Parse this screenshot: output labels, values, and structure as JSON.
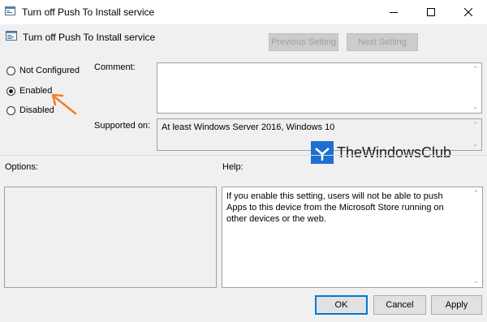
{
  "window": {
    "title": "Turn off Push To Install service"
  },
  "policy": {
    "name": "Turn off Push To Install service",
    "previous_setting_label": "Previous Setting",
    "next_setting_label": "Next Setting"
  },
  "state": {
    "options": [
      "Not Configured",
      "Enabled",
      "Disabled"
    ],
    "selected": "Enabled"
  },
  "comment": {
    "label": "Comment:",
    "value": ""
  },
  "supported_on": {
    "label": "Supported on:",
    "value": "At least Windows Server 2016, Windows 10"
  },
  "options_panel": {
    "label": "Options:"
  },
  "help_panel": {
    "label": "Help:",
    "text": "If you enable this setting, users will not be able to push Apps to this device from the Microsoft Store running on other devices or the web."
  },
  "watermark": {
    "text": "TheWindowsClub"
  },
  "buttons": {
    "ok": "OK",
    "cancel": "Cancel",
    "apply": "Apply"
  },
  "annotation": {
    "arrow_color": "#f47b20"
  },
  "colors": {
    "accent": "#0078d7",
    "logo_blue": "#1e6fd0"
  }
}
